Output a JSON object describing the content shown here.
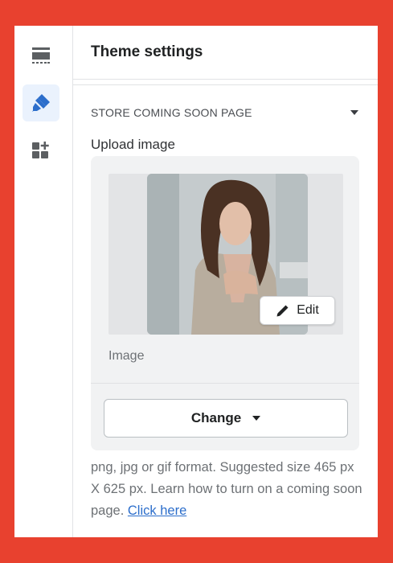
{
  "header": {
    "title": "Theme settings"
  },
  "sidebar": {
    "icons": [
      "sections-icon",
      "theme-brush-icon",
      "apps-add-icon"
    ],
    "active_index": 1
  },
  "section": {
    "title": "STORE COMING SOON PAGE",
    "upload_label": "Upload image",
    "image_caption": "Image",
    "edit_label": "Edit",
    "change_label": "Change",
    "help_text": "png, jpg or gif format. Suggested size 465 px X 625 px. Learn how to turn on a coming soon page.",
    "help_link": "Click here"
  },
  "colors": {
    "background": "#e8412f",
    "accent": "#2c6ecb",
    "active_rail_bg": "#eaf2fd"
  }
}
